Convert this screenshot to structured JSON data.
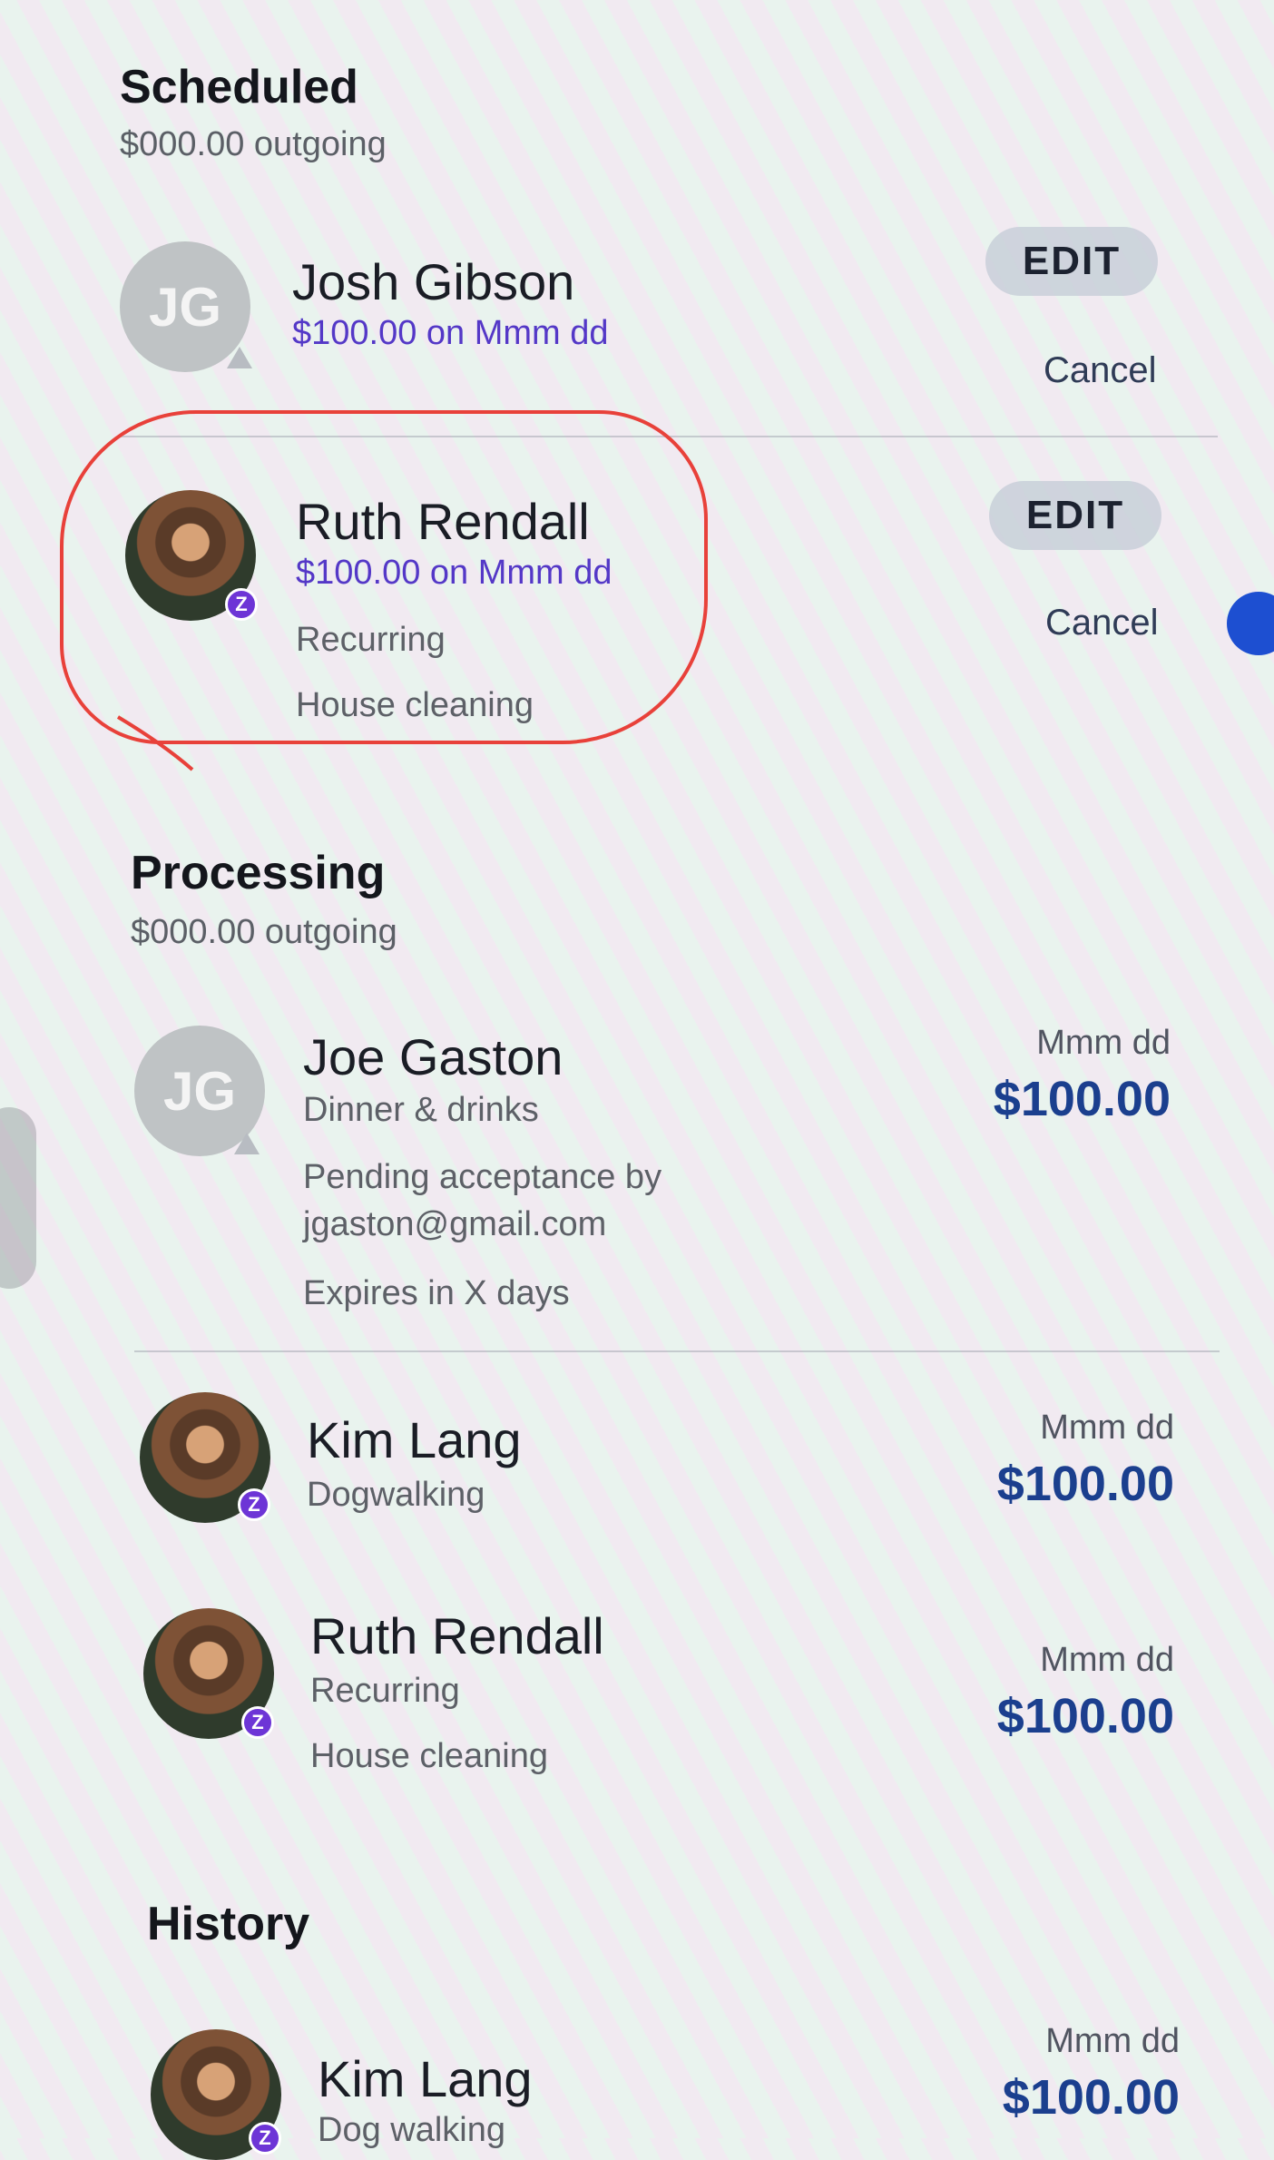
{
  "sections": {
    "scheduled": {
      "title": "Scheduled",
      "subtitle": "$000.00 outgoing"
    },
    "processing": {
      "title": "Processing",
      "subtitle": "$000.00 outgoing"
    },
    "history": {
      "title": "History"
    }
  },
  "scheduled_items": [
    {
      "name": "Josh Gibson",
      "initials": "JG",
      "detail": "$100.00 on Mmm dd",
      "edit_label": "EDIT",
      "cancel_label": "Cancel"
    },
    {
      "name": "Ruth Rendall",
      "badge": "Z",
      "detail": "$100.00 on Mmm dd",
      "recurring": "Recurring",
      "memo": "House cleaning",
      "edit_label": "EDIT",
      "cancel_label": "Cancel"
    }
  ],
  "processing_items": [
    {
      "name": "Joe Gaston",
      "initials": "JG",
      "memo": "Dinner & drinks",
      "status_line1": "Pending acceptance by",
      "status_line2": "jgaston@gmail.com",
      "expires": "Expires in X days",
      "date": "Mmm dd",
      "amount": "$100.00"
    },
    {
      "name": "Kim Lang",
      "badge": "Z",
      "memo": "Dogwalking",
      "date": "Mmm dd",
      "amount": "$100.00"
    },
    {
      "name": "Ruth Rendall",
      "badge": "Z",
      "recurring": "Recurring",
      "memo": "House cleaning",
      "date": "Mmm dd",
      "amount": "$100.00"
    }
  ],
  "history_items": [
    {
      "name": "Kim Lang",
      "badge": "Z",
      "memo": "Dog walking",
      "date": "Mmm dd",
      "amount": "$100.00"
    }
  ],
  "colors": {
    "accent": "#5438c7",
    "amount": "#1b3f8e",
    "annotation": "#e8413a",
    "zelle_badge": "#6d35d6"
  },
  "icons": {
    "warning": "pending-warning-icon",
    "zelle": "zelle-badge-icon",
    "avatar_photo": "contact-photo"
  }
}
